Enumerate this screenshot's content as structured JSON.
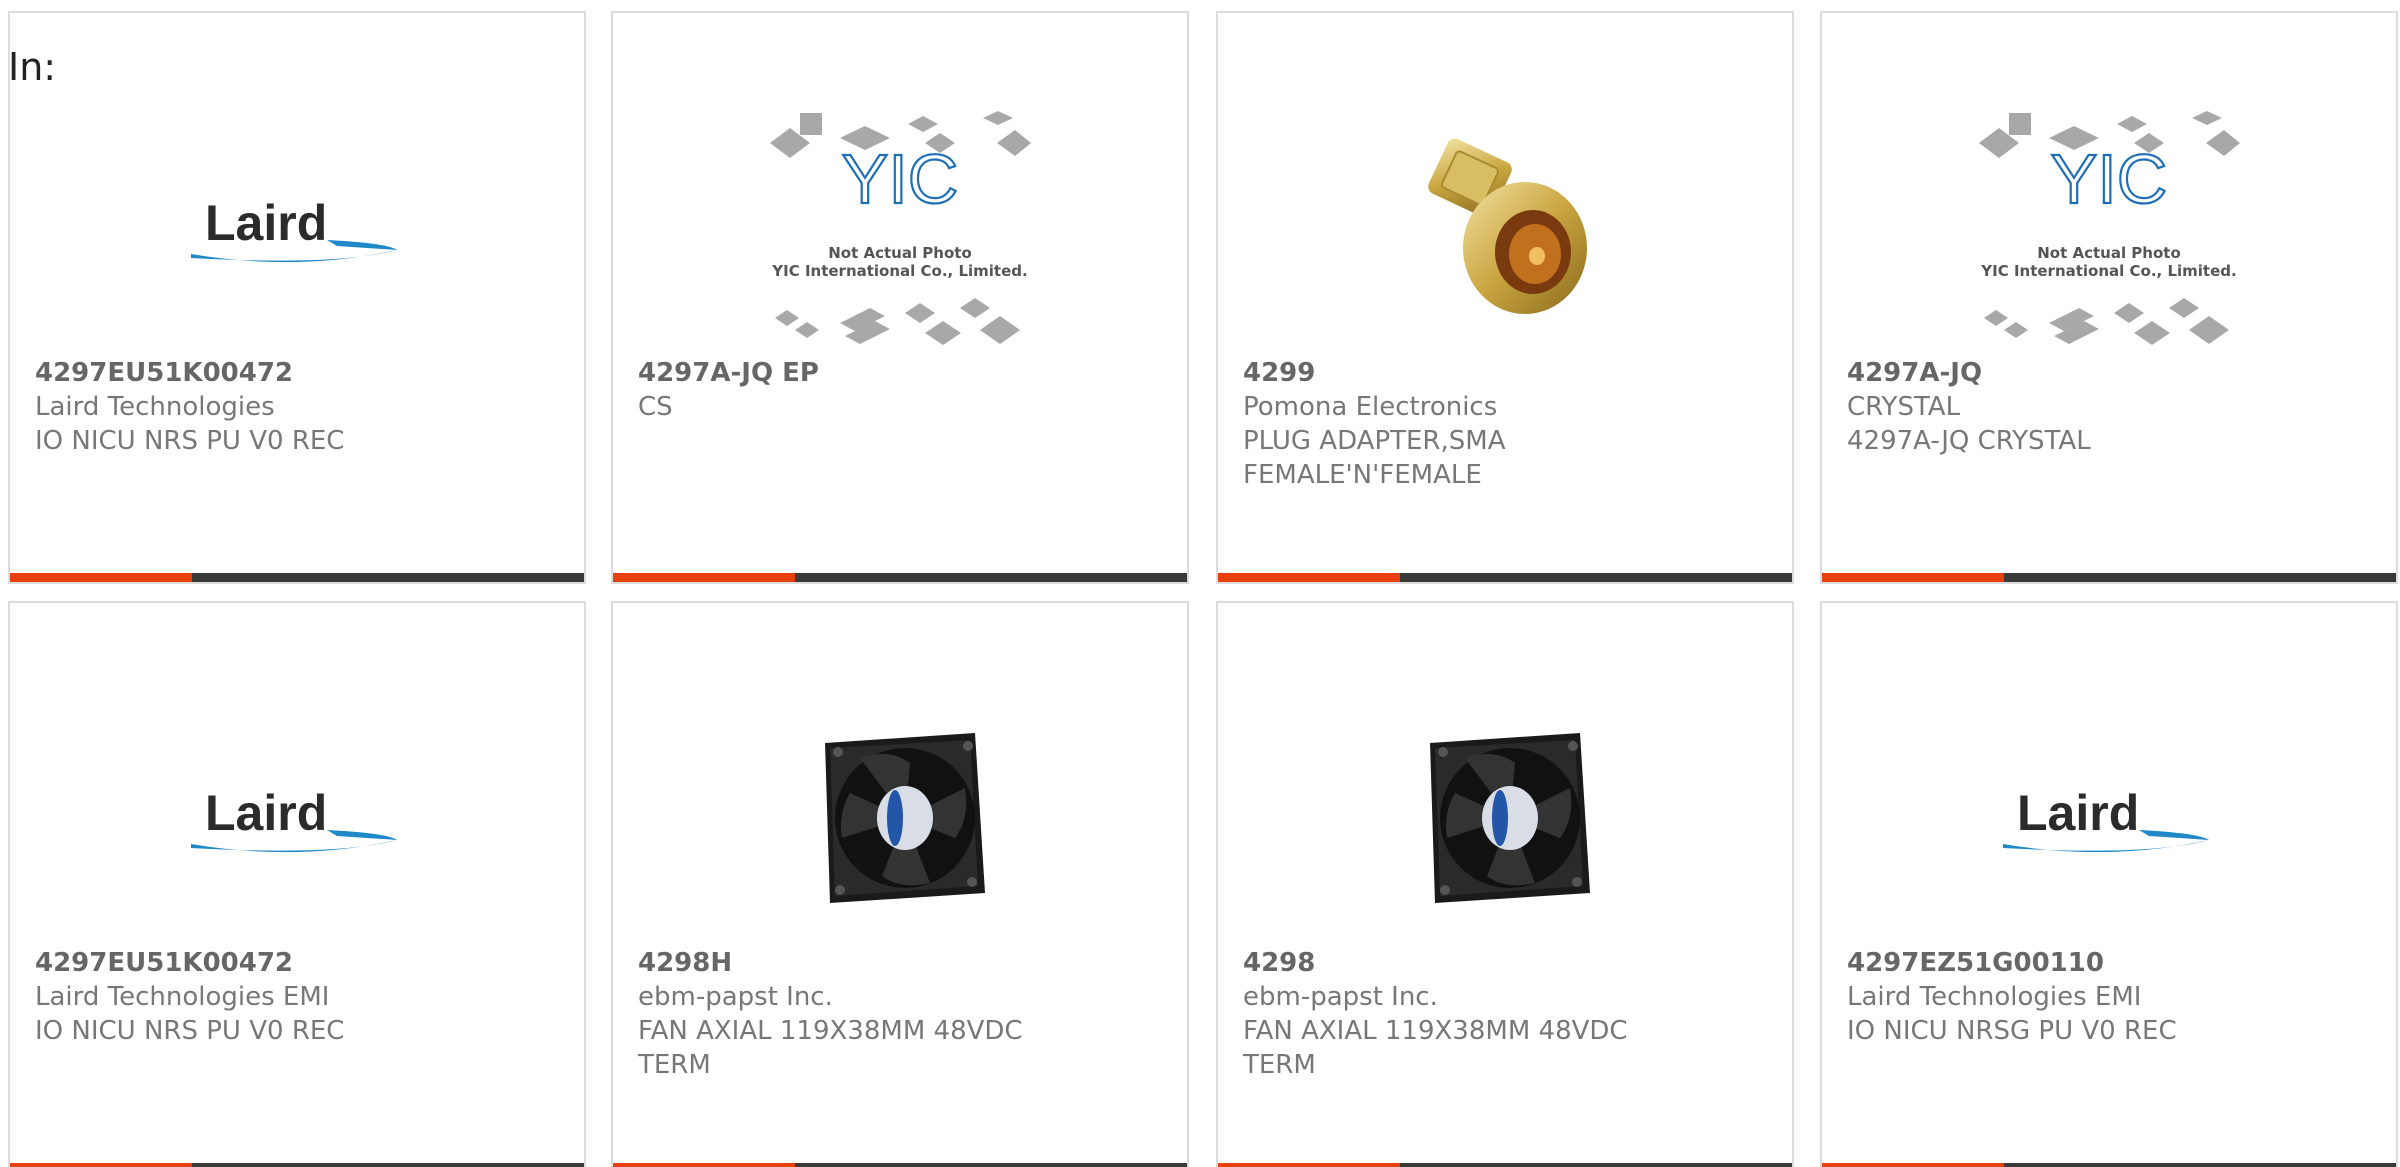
{
  "filter": {
    "in_label": "In:"
  },
  "cards": [
    {
      "part_number": "4297EU51K00472",
      "manufacturer": "Laird Technologies",
      "description": "IO NICU NRS PU V0 REC",
      "image": "laird-logo",
      "logo_text": "Laird"
    },
    {
      "part_number": "4297A-JQ EP",
      "manufacturer": "CS",
      "description": "",
      "image": "yic-placeholder",
      "placeholder_line1": "Not Actual Photo",
      "placeholder_line2": "YIC International Co., Limited.",
      "placeholder_logo": "YIC"
    },
    {
      "part_number": "4299",
      "manufacturer": "Pomona Electronics",
      "description": "PLUG ADAPTER,SMA\nFEMALE'N'FEMALE",
      "image": "sma-adapter-photo"
    },
    {
      "part_number": "4297A-JQ",
      "manufacturer": "CRYSTAL",
      "description": "4297A-JQ CRYSTAL",
      "image": "yic-placeholder",
      "placeholder_line1": "Not Actual Photo",
      "placeholder_line2": "YIC International Co., Limited.",
      "placeholder_logo": "YIC"
    },
    {
      "part_number": "4297EU51K00472",
      "manufacturer": "Laird Technologies EMI",
      "description": "IO NICU NRS PU V0 REC",
      "image": "laird-logo",
      "logo_text": "Laird"
    },
    {
      "part_number": "4298H",
      "manufacturer": "ebm-papst Inc.",
      "description": "FAN AXIAL 119X38MM 48VDC\nTERM",
      "image": "axial-fan-photo"
    },
    {
      "part_number": "4298",
      "manufacturer": "ebm-papst Inc.",
      "description": "FAN AXIAL 119X38MM 48VDC\nTERM",
      "image": "axial-fan-photo"
    },
    {
      "part_number": "4297EZ51G00110",
      "manufacturer": "Laird Technologies EMI",
      "description": "IO NICU NRSG PU V0 REC",
      "image": "laird-logo",
      "logo_text": "Laird"
    }
  ],
  "colors": {
    "accent": "#e8400c",
    "bar": "#3a3a3a",
    "text": "#777777",
    "border": "#dcdcdc",
    "laird_swoosh": "#1e88c8"
  }
}
